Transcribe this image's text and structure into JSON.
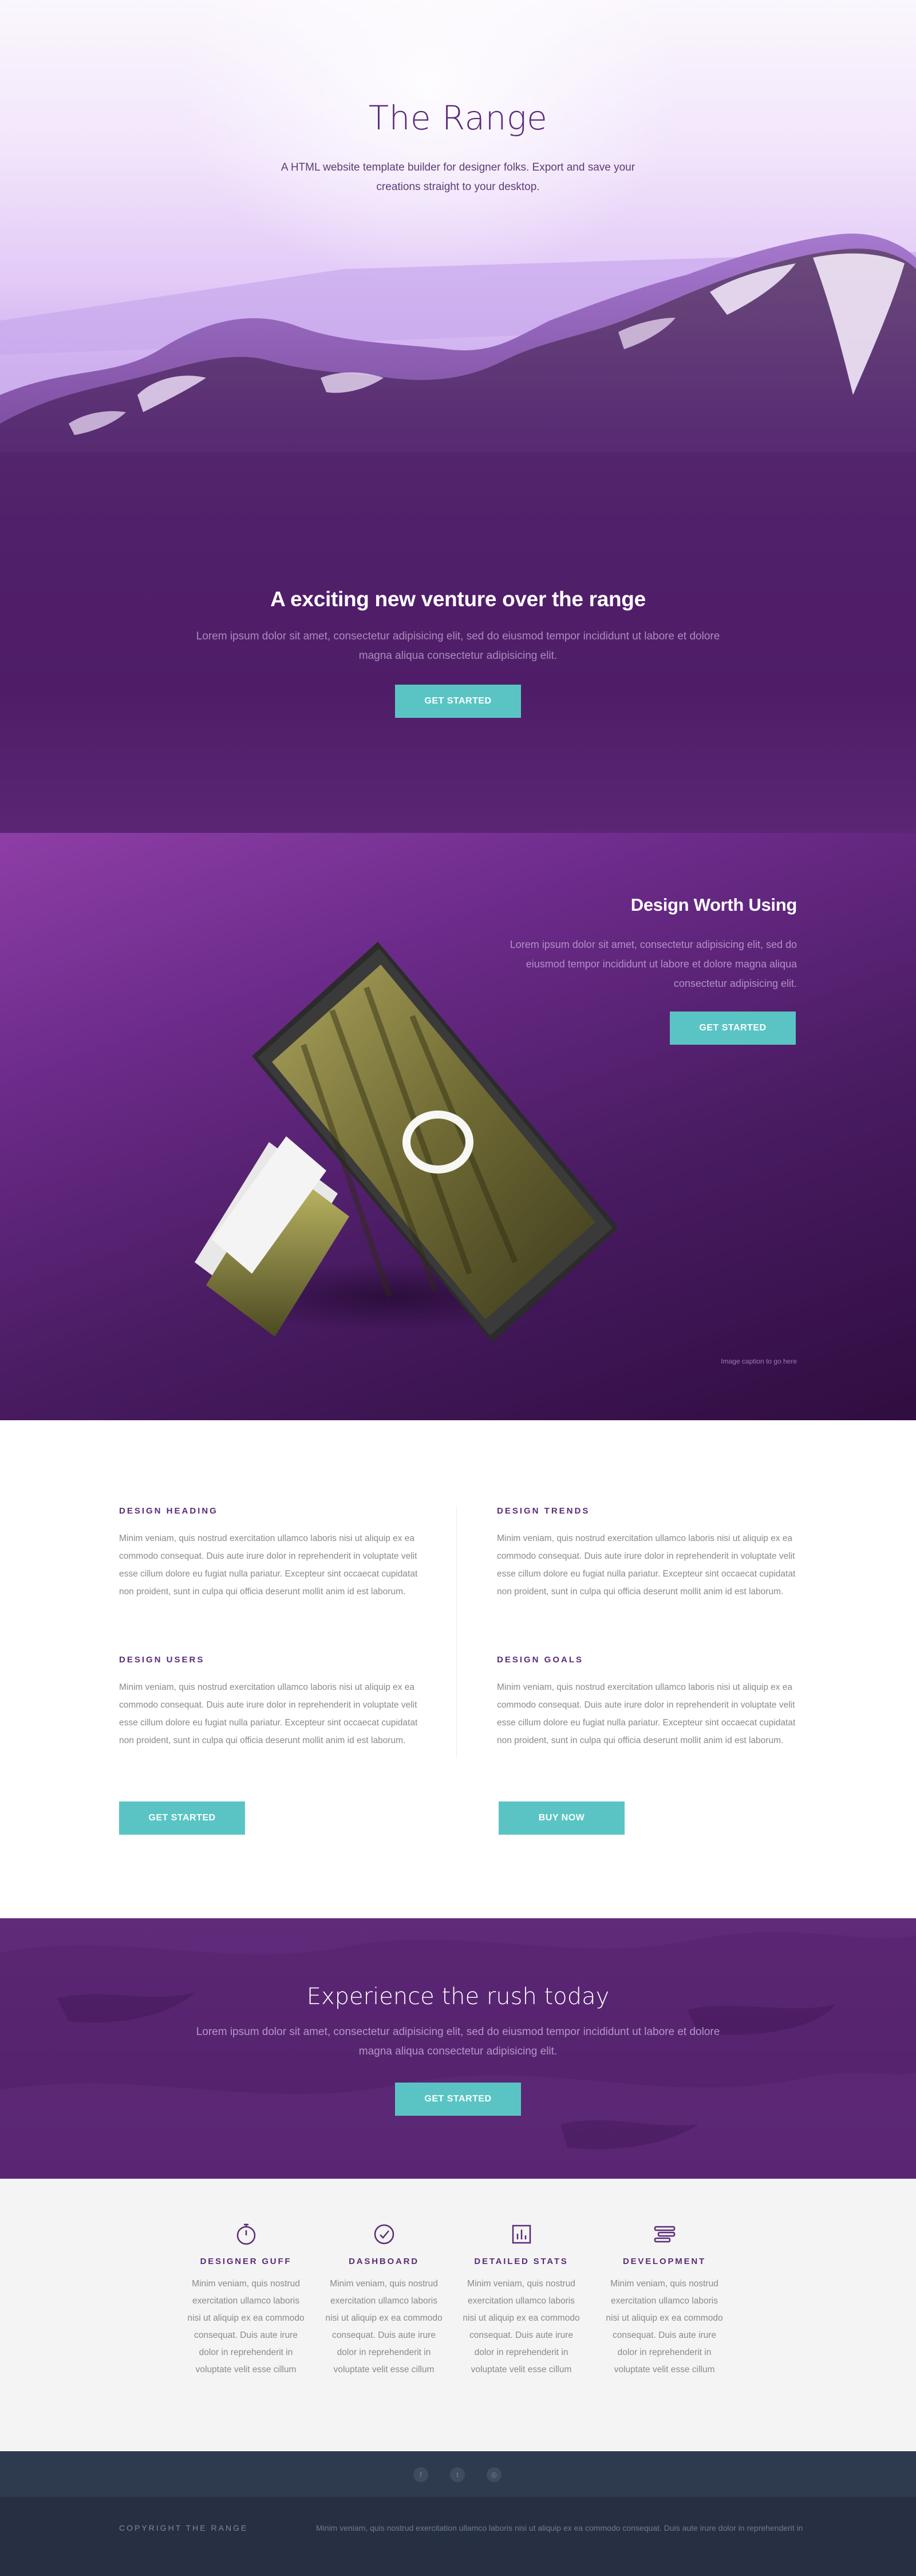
{
  "hero": {
    "title": "The Range",
    "subtitle": "A HTML website template builder for designer folks. Export and save your creations straight to your desktop."
  },
  "venture": {
    "title": "A exciting new venture over the range",
    "text": "Lorem ipsum dolor sit amet, consectetur adipisicing elit, sed do eiusmod tempor incididunt ut labore et dolore magna aliqua consectetur adipisicing elit.",
    "button": "GET STARTED"
  },
  "design": {
    "title": "Design Worth Using",
    "text": "Lorem ipsum dolor sit amet, consectetur adipisicing elit, sed do eiusmod tempor incididunt ut labore et dolore magna aliqua consectetur adipisicing elit.",
    "button": "GET STARTED",
    "caption": "Image caption to go here"
  },
  "features": {
    "items": [
      {
        "heading": "DESIGN HEADING",
        "text": "Minim veniam, quis nostrud exercitation ullamco laboris nisi ut aliquip ex ea commodo consequat. Duis aute irure dolor in reprehenderit in voluptate velit esse cillum dolore eu fugiat nulla pariatur. Excepteur sint occaecat cupidatat non proident, sunt in culpa qui officia deserunt mollit anim id est laborum."
      },
      {
        "heading": "DESIGN TRENDS",
        "text": "Minim veniam, quis nostrud exercitation ullamco laboris nisi ut aliquip ex ea commodo consequat. Duis aute irure dolor in reprehenderit in voluptate velit esse cillum dolore eu fugiat nulla pariatur. Excepteur sint occaecat cupidatat non proident, sunt in culpa qui officia deserunt mollit anim id est laborum."
      },
      {
        "heading": "DESIGN USERS",
        "text": "Minim veniam, quis nostrud exercitation ullamco laboris nisi ut aliquip ex ea commodo consequat. Duis aute irure dolor in reprehenderit in voluptate velit esse cillum dolore eu fugiat nulla pariatur. Excepteur sint occaecat cupidatat non proident, sunt in culpa qui officia deserunt mollit anim id est laborum."
      },
      {
        "heading": "DESIGN GOALS",
        "text": "Minim veniam, quis nostrud exercitation ullamco laboris nisi ut aliquip ex ea commodo consequat. Duis aute irure dolor in reprehenderit in voluptate velit esse cillum dolore eu fugiat nulla pariatur. Excepteur sint occaecat cupidatat non proident, sunt in culpa qui officia deserunt mollit anim id est laborum."
      }
    ],
    "button_start": "GET STARTED",
    "button_buy": "BUY NOW"
  },
  "rush": {
    "title": "Experience the rush today",
    "text": "Lorem ipsum dolor sit amet, consectetur adipisicing elit, sed do eiusmod tempor incididunt ut labore et dolore magna aliqua consectetur adipisicing elit.",
    "button": "GET STARTED"
  },
  "services": [
    {
      "icon": "stopwatch-icon",
      "title": "DESIGNER GUFF",
      "text": "Minim veniam, quis nostrud exercitation ullamco laboris nisi ut aliquip ex ea commodo consequat. Duis aute irure dolor in reprehenderit in voluptate velit esse cillum"
    },
    {
      "icon": "gauge-icon",
      "title": "DASHBOARD",
      "text": "Minim veniam, quis nostrud exercitation ullamco laboris nisi ut aliquip ex ea commodo consequat. Duis aute irure dolor in reprehenderit in voluptate velit esse cillum"
    },
    {
      "icon": "bar-chart-icon",
      "title": "DETAILED STATS",
      "text": "Minim veniam, quis nostrud exercitation ullamco laboris nisi ut aliquip ex ea commodo consequat. Duis aute irure dolor in reprehenderit in voluptate velit esse cillum"
    },
    {
      "icon": "stack-icon",
      "title": "DEVELOPMENT",
      "text": "Minim veniam, quis nostrud exercitation ullamco laboris nisi ut aliquip ex ea commodo consequat. Duis aute irure dolor in reprehenderit in voluptate velit esse cillum"
    }
  ],
  "footer": {
    "copyright": "COPYRIGHT THE RANGE",
    "text": "Minim veniam, quis nostrud exercitation ullamco laboris nisi ut aliquip ex ea commodo consequat. Duis aute irure dolor in reprehenderit in",
    "social_icons": [
      "facebook-icon",
      "twitter-icon",
      "dribbble-icon"
    ]
  },
  "colors": {
    "brand_purple": "#5a2b78",
    "accent_teal": "#5ac4c4",
    "footer_dark": "#263042"
  }
}
